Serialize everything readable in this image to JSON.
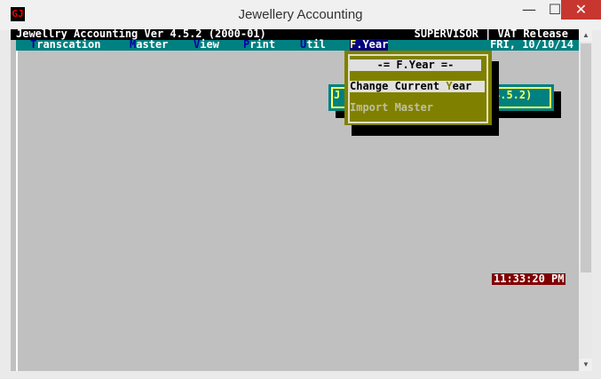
{
  "window": {
    "title": "Jewellery Accounting",
    "icon": "app-logo-icon",
    "controls": {
      "minimize": "—",
      "maximize": "☐",
      "close": "✕"
    }
  },
  "app": {
    "header_left": "Jewellry Accounting Ver 4.5.2 (2000-01)",
    "header_right": "SUPERVISOR | VAT Release",
    "date": "FRI, 10/10/14",
    "menus": [
      {
        "key": "T",
        "rest": "ranscation"
      },
      {
        "key": "M",
        "rest": "aster"
      },
      {
        "key": "V",
        "rest": "iew"
      },
      {
        "key": "P",
        "rest": "rint"
      },
      {
        "key": "U",
        "rest": "til"
      },
      {
        "key": "F",
        "rest": ".Year",
        "selected": true
      }
    ],
    "info_panel": {
      "left_text": "J",
      "right_text": "4.5.2)"
    },
    "dropdown": {
      "title": "-= F.Year =-",
      "items": [
        {
          "pre": "Change Current ",
          "key": "Y",
          "post": "ear",
          "highlighted": true
        },
        {
          "label": "Import Master",
          "disabled": true
        }
      ]
    },
    "clock": "11:33:20 PM"
  },
  "colors": {
    "header_bg": "#000000",
    "menu_bg": "#008080",
    "menu_selected_bg": "#000080",
    "dropdown_bg": "#808000",
    "clock_bg": "#800000",
    "desktop_bg": "#c0c0c0"
  }
}
